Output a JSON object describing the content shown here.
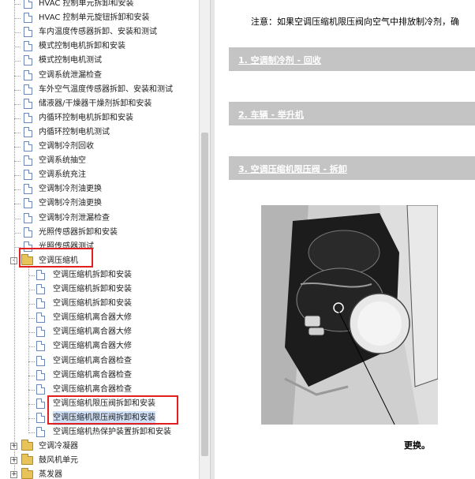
{
  "tree": {
    "items": [
      {
        "label": "HVAC 控制单元拆卸和安装",
        "kind": "doc",
        "level": 1
      },
      {
        "label": "HVAC 控制单元旋钮拆卸和安装",
        "kind": "doc",
        "level": 1
      },
      {
        "label": "车内温度传感器拆卸、安装和测试",
        "kind": "doc",
        "level": 1
      },
      {
        "label": "模式控制电机拆卸和安装",
        "kind": "doc",
        "level": 1
      },
      {
        "label": "模式控制电机测试",
        "kind": "doc",
        "level": 1
      },
      {
        "label": "空调系统泄漏检查",
        "kind": "doc",
        "level": 1
      },
      {
        "label": "车外空气温度传感器拆卸、安装和测试",
        "kind": "doc",
        "level": 1
      },
      {
        "label": "储液器/干燥器干燥剂拆卸和安装",
        "kind": "doc",
        "level": 1
      },
      {
        "label": "内循环控制电机拆卸和安装",
        "kind": "doc",
        "level": 1
      },
      {
        "label": "内循环控制电机测试",
        "kind": "doc",
        "level": 1
      },
      {
        "label": "空调制冷剂回收",
        "kind": "doc",
        "level": 1
      },
      {
        "label": "空调系统抽空",
        "kind": "doc",
        "level": 1
      },
      {
        "label": "空调系统充注",
        "kind": "doc",
        "level": 1
      },
      {
        "label": "空调制冷剂油更换",
        "kind": "doc",
        "level": 1
      },
      {
        "label": "空调制冷剂油更换",
        "kind": "doc",
        "level": 1
      },
      {
        "label": "空调制冷剂泄漏检查",
        "kind": "doc",
        "level": 1
      },
      {
        "label": "光照传感器拆卸和安装",
        "kind": "doc",
        "level": 1
      },
      {
        "label": "光照传感器测试",
        "kind": "doc",
        "level": 1
      },
      {
        "label": "空调压缩机",
        "kind": "folder",
        "level": 0,
        "expander": "-"
      },
      {
        "label": "空调压缩机拆卸和安装",
        "kind": "doc",
        "level": 2
      },
      {
        "label": "空调压缩机拆卸和安装",
        "kind": "doc",
        "level": 2
      },
      {
        "label": "空调压缩机拆卸和安装",
        "kind": "doc",
        "level": 2
      },
      {
        "label": "空调压缩机离合器大修",
        "kind": "doc",
        "level": 2
      },
      {
        "label": "空调压缩机离合器大修",
        "kind": "doc",
        "level": 2
      },
      {
        "label": "空调压缩机离合器大修",
        "kind": "doc",
        "level": 2
      },
      {
        "label": "空调压缩机离合器检查",
        "kind": "doc",
        "level": 2
      },
      {
        "label": "空调压缩机离合器检查",
        "kind": "doc",
        "level": 2
      },
      {
        "label": "空调压缩机离合器检查",
        "kind": "doc",
        "level": 2
      },
      {
        "label": "空调压缩机限压阀拆卸和安装",
        "kind": "doc",
        "level": 2
      },
      {
        "label": "空调压缩机限压阀拆卸和安装",
        "kind": "doc",
        "level": 2,
        "selected": true
      },
      {
        "label": "空调压缩机热保护装置拆卸和安装",
        "kind": "doc",
        "level": 2
      },
      {
        "label": "空调冷凝器",
        "kind": "folder",
        "level": 0,
        "expander": "+"
      },
      {
        "label": "鼓风机单元",
        "kind": "folder",
        "level": 0,
        "expander": "+"
      },
      {
        "label": "蒸发器",
        "kind": "folder",
        "level": 0,
        "expander": "+"
      }
    ]
  },
  "content": {
    "notice": "注意：如果空调压缩机限压阀向空气中排放制冷剂，确",
    "sections": [
      {
        "label": "1. 空调制冷剂 - 回收"
      },
      {
        "label": "2. 车辆 - 举升机"
      },
      {
        "label": "3. 空调压缩机限压阀 - 拆卸"
      }
    ],
    "caption": "更换。"
  }
}
